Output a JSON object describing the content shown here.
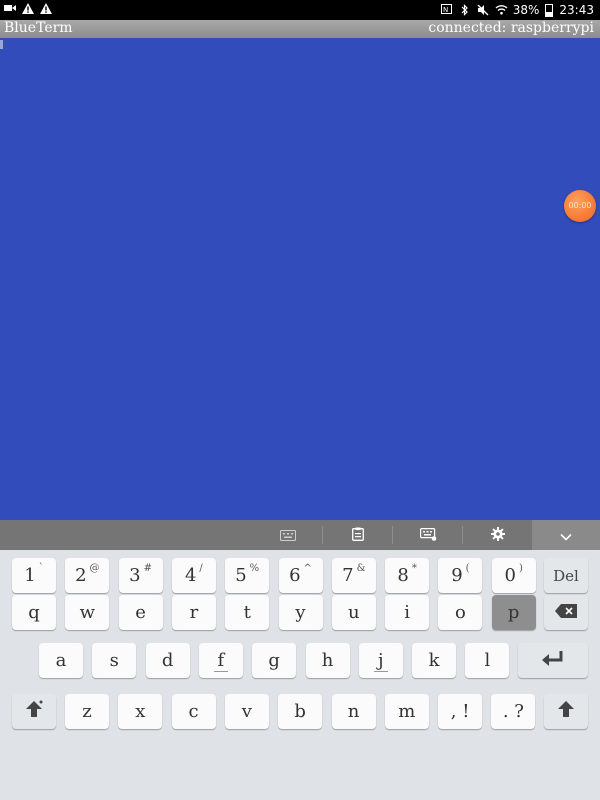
{
  "status_bar": {
    "left_icons": [
      "video-icon",
      "warning-icon",
      "warning-icon"
    ],
    "battery": "38%",
    "time": "23:43"
  },
  "title_bar": {
    "app_name": "BlueTerm",
    "connection": "connected: raspberrypi"
  },
  "terminal": {
    "background": "#334cbb"
  },
  "floating_button": {
    "label": "00:00",
    "color": "#f0641c"
  },
  "keyboard_toolbar": {
    "items": [
      "keyboard-icon",
      "clipboard-icon",
      "keyboard-settings-icon",
      "gear-icon",
      "chevron-down-icon"
    ]
  },
  "keyboard": {
    "row1": [
      {
        "main": "1",
        "sup": "`"
      },
      {
        "main": "2",
        "sup": "@"
      },
      {
        "main": "3",
        "sup": "#"
      },
      {
        "main": "4",
        "sup": "/"
      },
      {
        "main": "5",
        "sup": "%"
      },
      {
        "main": "6",
        "sup": "^"
      },
      {
        "main": "7",
        "sup": "&"
      },
      {
        "main": "8",
        "sup": "*"
      },
      {
        "main": "9",
        "sup": "("
      },
      {
        "main": "0",
        "sup": ")"
      }
    ],
    "del_label": "Del",
    "row2": [
      "q",
      "w",
      "e",
      "r",
      "t",
      "y",
      "u",
      "i",
      "o",
      "p"
    ],
    "row3": [
      "a",
      "s",
      "d",
      "f",
      "g",
      "h",
      "j",
      "k",
      "l"
    ],
    "row4": [
      "z",
      "x",
      "c",
      "v",
      "b",
      "n",
      "m"
    ],
    "comma_key": ", !",
    "period_key": ". ?",
    "pressed_key": "p"
  }
}
